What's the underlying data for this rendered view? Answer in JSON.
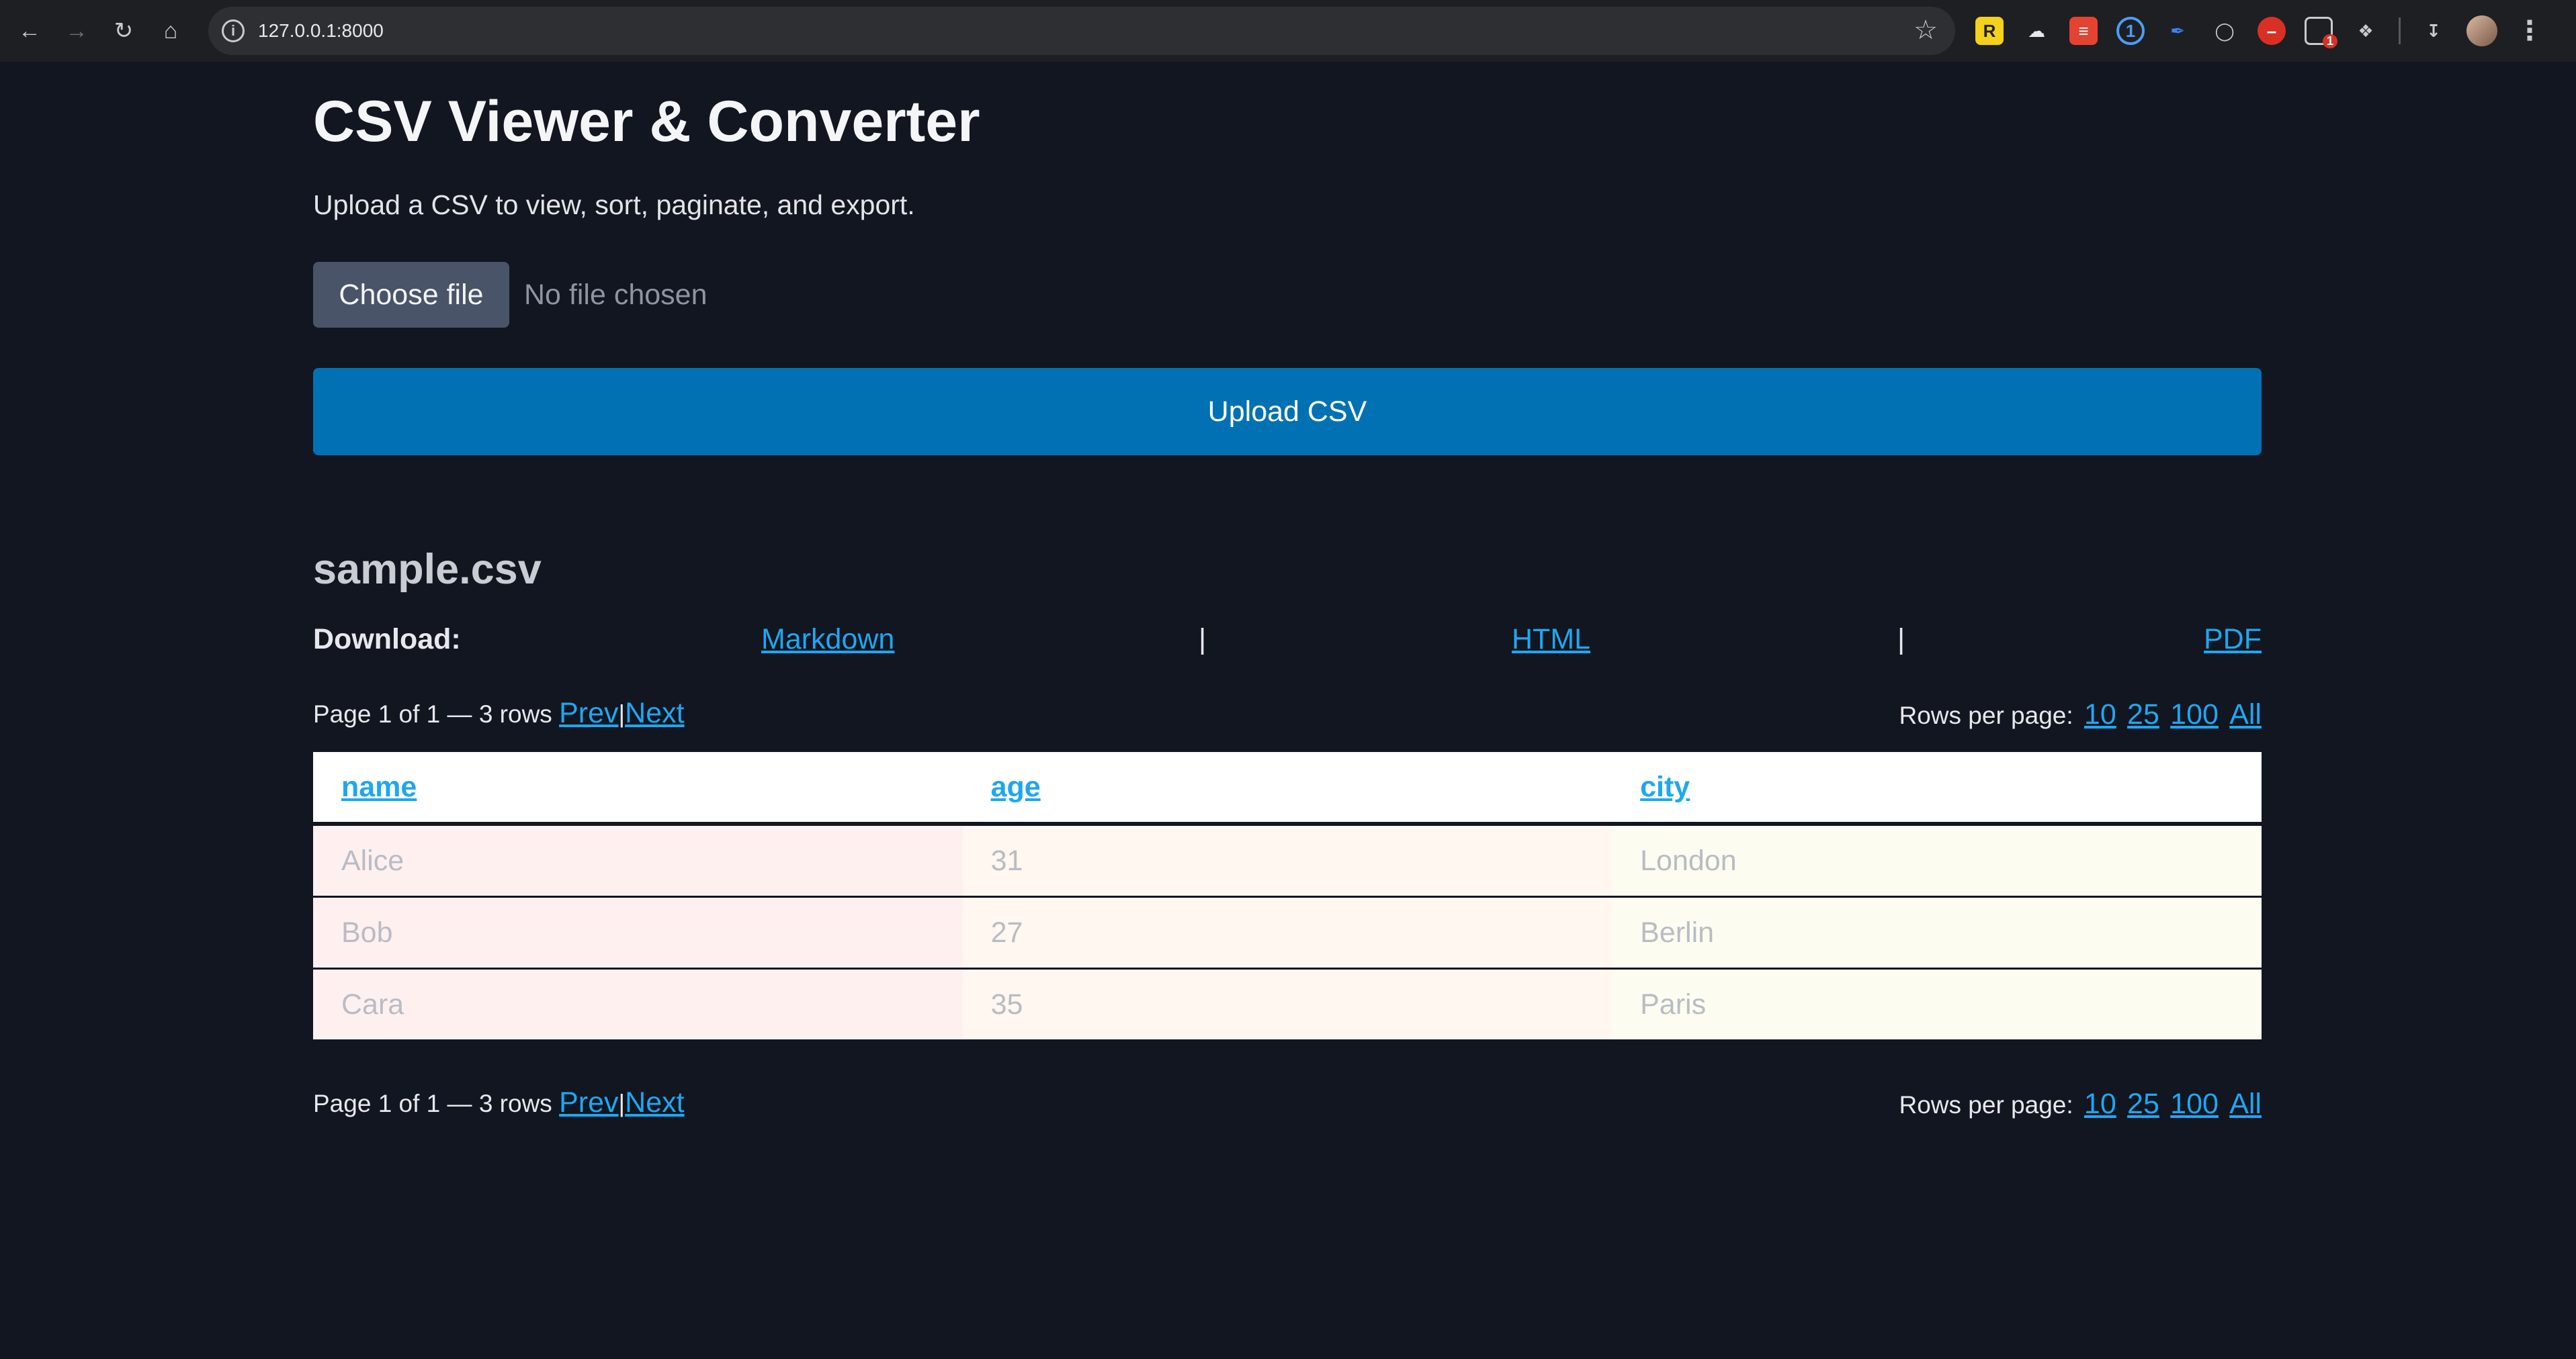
{
  "browser": {
    "url": "127.0.0.1:8000",
    "ext_badge_count": "1"
  },
  "page": {
    "title": "CSV Viewer & Converter",
    "subtitle": "Upload a CSV to view, sort, paginate, and export.",
    "choose_file_label": "Choose file",
    "no_file_label": "No file chosen",
    "upload_label": "Upload CSV",
    "file_name": "sample.csv"
  },
  "download": {
    "label": "Download:",
    "links": [
      "Markdown",
      "HTML",
      "PDF"
    ],
    "separator": "|"
  },
  "pager": {
    "status": "Page 1 of 1 — 3 rows",
    "prev": "Prev",
    "next": "Next",
    "separator": "|",
    "rows_per_page_label": "Rows per page:",
    "rows_per_page_options": [
      "10",
      "25",
      "100",
      "All"
    ]
  },
  "table": {
    "columns": [
      "name",
      "age",
      "city"
    ],
    "rows": [
      [
        "Alice",
        "31",
        "London"
      ],
      [
        "Bob",
        "27",
        "Berlin"
      ],
      [
        "Cara",
        "35",
        "Paris"
      ]
    ]
  }
}
